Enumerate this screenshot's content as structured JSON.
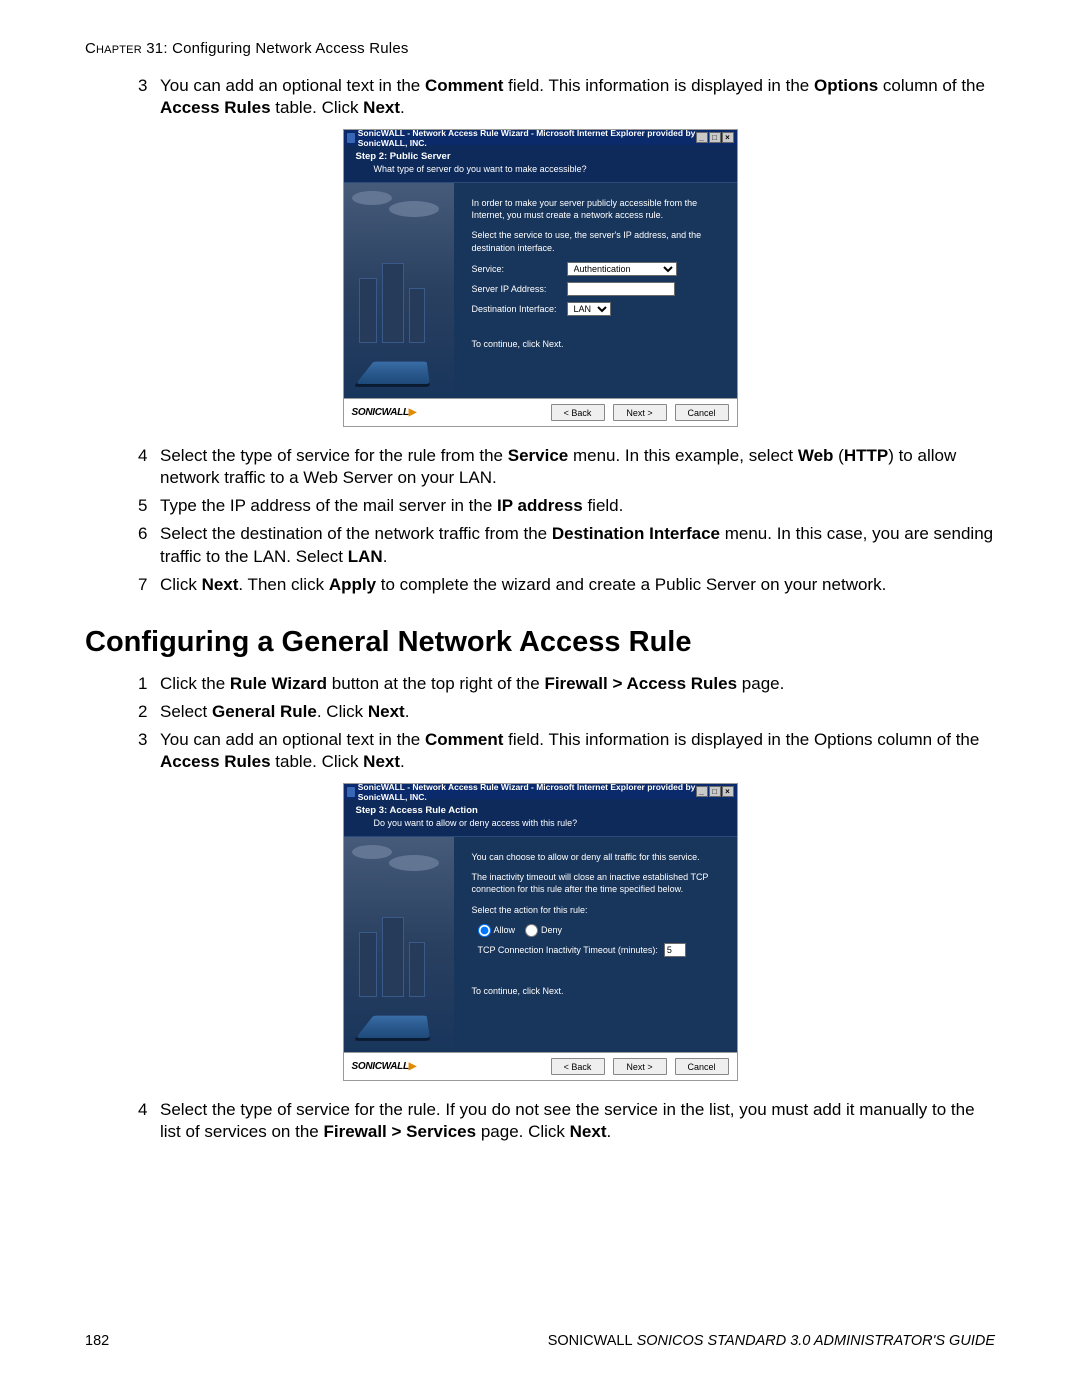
{
  "chapter": {
    "label": "Chapter",
    "num": "31",
    "title": "Configuring Network Access Rules"
  },
  "stepsA": {
    "s3": [
      "You can add an optional text in the ",
      "Comment",
      " field. This information is displayed in the ",
      "Options",
      " column of the ",
      "Access Rules",
      " table. Click ",
      "Next",
      "."
    ],
    "s4": [
      "Select the type of service for the rule from the ",
      "Service",
      " menu. In this example, select ",
      "Web",
      " (",
      "HTTP",
      ") to allow network traffic to a Web Server on your LAN."
    ],
    "s5": [
      "Type the IP address of the mail server in the ",
      "IP address",
      " field."
    ],
    "s6": [
      "Select the destination of the network traffic from the ",
      "Destination Interface",
      " menu. In this case, you are sending traffic to the LAN. Select ",
      "LAN",
      "."
    ],
    "s7": [
      "Click ",
      "Next",
      ". Then click ",
      "Apply",
      " to complete the wizard and create a Public Server on your network."
    ]
  },
  "heading": "Configuring a General Network Access Rule",
  "stepsB": {
    "s1": [
      "Click the ",
      "Rule Wizard",
      " button at the top right of the ",
      "Firewall > Access Rules",
      " page."
    ],
    "s2": [
      "Select ",
      "General Rule",
      ". Click ",
      "Next",
      "."
    ],
    "s3": [
      "You can add an optional text in the ",
      "Comment",
      " field. This information is displayed in the Options column of the ",
      "Access Rules",
      " table. Click ",
      "Next",
      "."
    ],
    "s4": [
      "Select the type of service for the rule. If you do not see the service in the list, you must add it manually to the list of services on the ",
      "Firewall > Services",
      " page. Click ",
      "Next",
      "."
    ]
  },
  "wizard1": {
    "windowTitle": "SonicWALL - Network Access Rule Wizard - Microsoft Internet Explorer provided by SonicWALL, INC.",
    "stepTitle": "Step 2: Public Server",
    "stepSub": "What type of server do you want to make accessible?",
    "intro1": "In order to make your server publicly accessible from the Internet, you must create a network access rule.",
    "intro2": "Select the service to use, the server's IP address, and the destination interface.",
    "labels": {
      "service": "Service:",
      "serverIp": "Server IP Address:",
      "dest": "Destination Interface:"
    },
    "values": {
      "service": "Authentication",
      "serverIp": "",
      "dest": "LAN"
    },
    "continue": "To continue, click Next.",
    "buttons": {
      "back": "< Back",
      "next": "Next >",
      "cancel": "Cancel"
    },
    "logo": "SONICWALL"
  },
  "wizard2": {
    "windowTitle": "SonicWALL - Network Access Rule Wizard - Microsoft Internet Explorer provided by SonicWALL, INC.",
    "stepTitle": "Step 3: Access Rule Action",
    "stepSub": "Do you want to allow or deny access with this rule?",
    "intro1": "You can choose to allow or deny all traffic for this service.",
    "intro2": "The inactivity timeout will close an inactive established TCP connection for this rule after the time specified below.",
    "selectAction": "Select the action for this rule:",
    "allow": "Allow",
    "deny": "Deny",
    "timeoutLabel": "TCP Connection Inactivity Timeout (minutes):",
    "timeoutValue": "5",
    "continue": "To continue, click Next.",
    "buttons": {
      "back": "< Back",
      "next": "Next >",
      "cancel": "Cancel"
    },
    "logo": "SONICWALL"
  },
  "footer": {
    "pageNum": "182",
    "guide": "SonicWALL SonicOS Standard 3.0 Administrator's Guide"
  }
}
